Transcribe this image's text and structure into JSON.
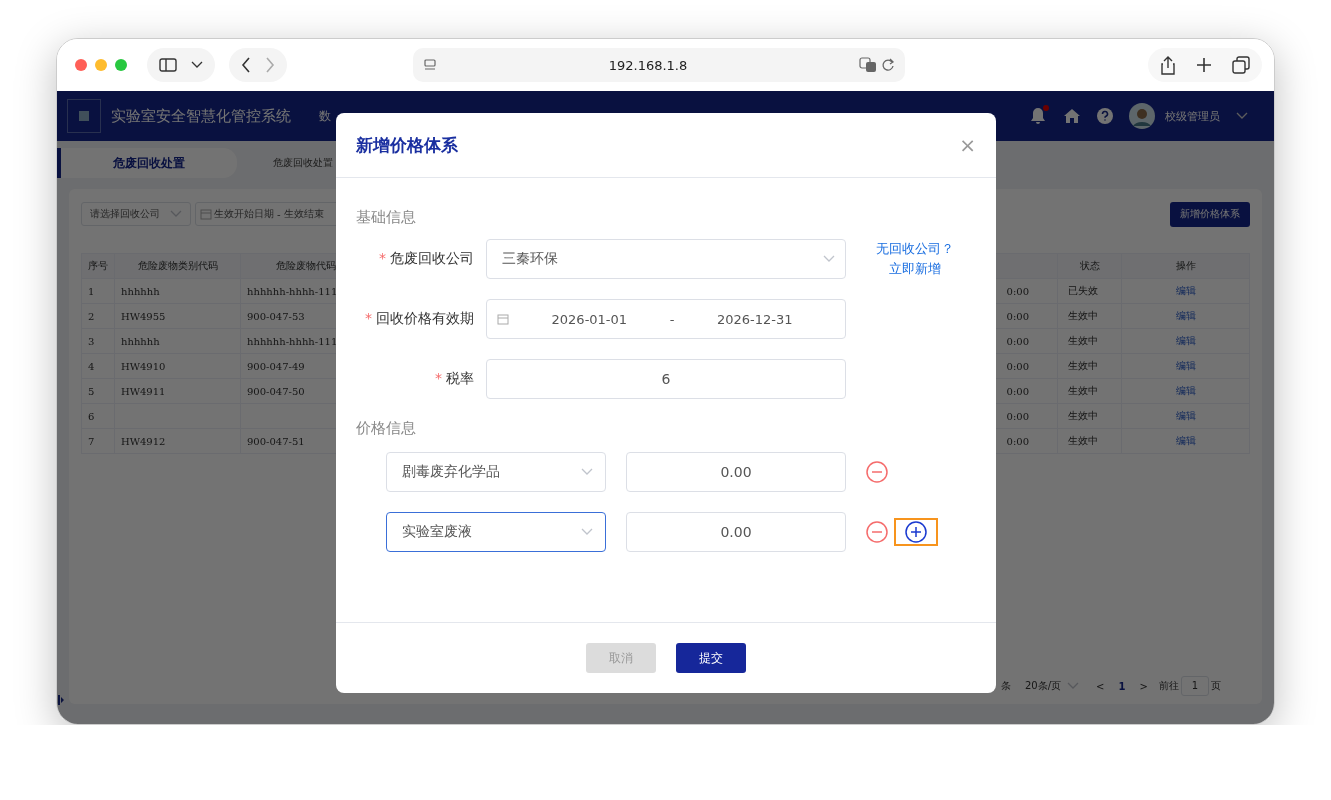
{
  "browser": {
    "address": "192.168.1.8"
  },
  "app": {
    "title": "实验室安全智慧化管控系统",
    "nav_item": "数",
    "user": "校级管理员",
    "notification": true,
    "tab": {
      "label": "危废回收处置",
      "selected": true
    },
    "breadcrumb": "危废回收处置",
    "filters": {
      "company_placeholder": "请选择回收公司",
      "start_placeholder": "生效开始日期",
      "separator": "-",
      "end_placeholder": "生效结束"
    },
    "add_button": "新增价格体系",
    "table": {
      "columns": [
        {
          "label": "序号"
        },
        {
          "label": "危险废物类别代码"
        },
        {
          "label": "危险废物代码"
        },
        {},
        {
          "label": "状态"
        },
        {
          "label": "操作"
        }
      ],
      "rows": [
        {
          "cells": [
            "1",
            "hhhhhh",
            "hhhhhh-hhhh-111",
            "0:00",
            "已失效",
            "编辑"
          ]
        },
        {
          "cells": [
            "2",
            "HW4955",
            "900-047-53",
            "0:00",
            "生效中",
            "编辑"
          ]
        },
        {
          "cells": [
            "3",
            "hhhhhh",
            "hhhhhh-hhhh-111",
            "0:00",
            "生效中",
            "编辑"
          ]
        },
        {
          "cells": [
            "4",
            "HW4910",
            "900-047-49",
            "0:00",
            "生效中",
            "编辑"
          ]
        },
        {
          "cells": [
            "5",
            "HW4911",
            "900-047-50",
            "0:00",
            "生效中",
            "编辑"
          ]
        },
        {
          "cells": [
            "6",
            null,
            null,
            "0:00",
            "生效中",
            "编辑"
          ]
        },
        {
          "cells": [
            "7",
            "HW4912",
            "900-047-51",
            "0:00",
            "生效中",
            "编辑"
          ]
        }
      ]
    },
    "pagination": {
      "total": "条",
      "page_size": "20条/页",
      "prev": "<",
      "current": "1",
      "next": ">",
      "goto_label": "前往",
      "goto_value": "1",
      "goto_unit": "页"
    }
  },
  "dialog": {
    "title": "新增价格体系",
    "close": "×",
    "required_mark": "*",
    "section_basic": "基础信息",
    "company": {
      "label": "危废回收公司",
      "required": true,
      "value": "三秦环保"
    },
    "company_link": [
      "无回收公司？",
      "立即新增"
    ],
    "period": {
      "label": "回收价格有效期",
      "required": true,
      "start": "2026-01-01",
      "separator": "-",
      "end": "2026-12-31"
    },
    "tax": {
      "label": "税率",
      "required": true,
      "value": "6"
    },
    "section_price": "价格信息",
    "price_rows": [
      {
        "category": "剧毒废弃化学品",
        "price": "0.00",
        "focused": false
      },
      {
        "category": "实验室废液",
        "price": "0.00",
        "focused": true
      }
    ],
    "add_row": {
      "highlighted": true
    },
    "buttons": [
      {
        "label": "取消",
        "kind": "cancel",
        "disabled": true
      },
      {
        "label": "提交",
        "kind": "submit",
        "disabled": false
      }
    ]
  }
}
